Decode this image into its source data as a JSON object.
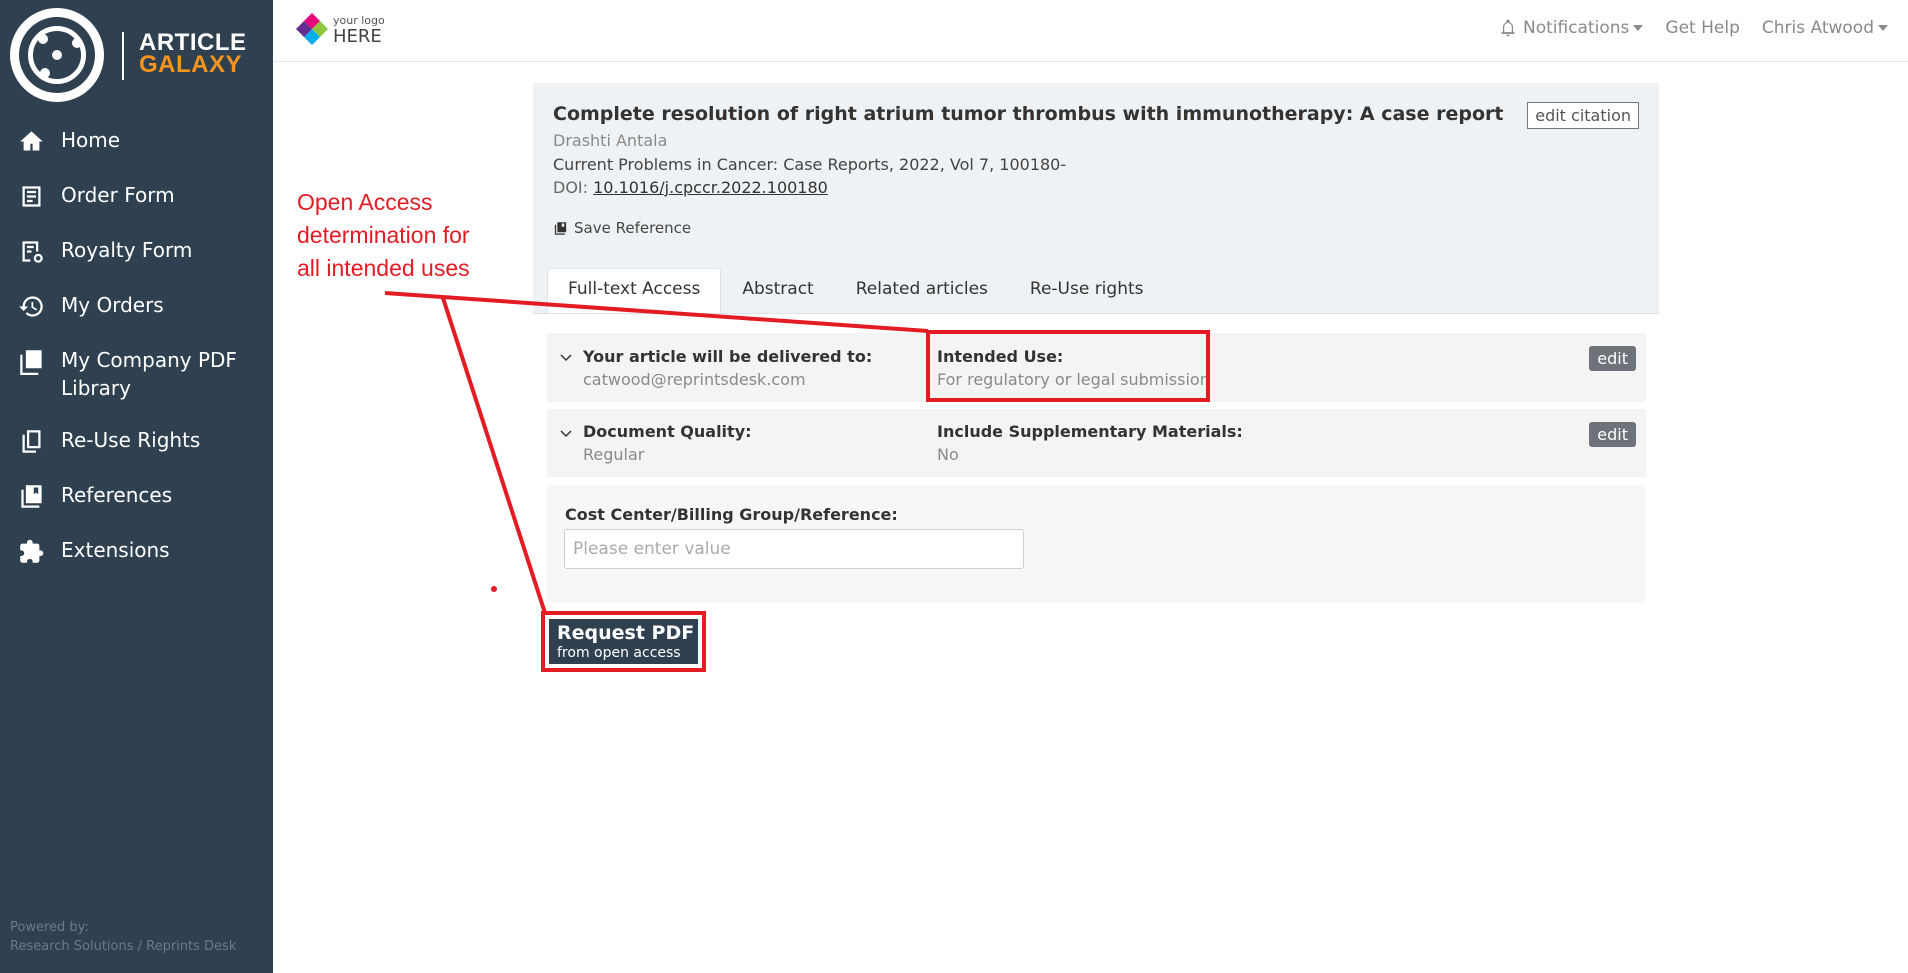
{
  "sidebar": {
    "brand": {
      "line1": "ARTICLE",
      "line2": "GALAXY"
    },
    "items": [
      {
        "label": "Home",
        "icon": "home-icon"
      },
      {
        "label": "Order Form",
        "icon": "form-icon"
      },
      {
        "label": "Royalty Form",
        "icon": "royalty-form-icon"
      },
      {
        "label": "My Orders",
        "icon": "history-icon"
      },
      {
        "label": "My Company PDF Library",
        "icon": "pdf-icon"
      },
      {
        "label": "Re-Use Rights",
        "icon": "copy-icon"
      },
      {
        "label": "References",
        "icon": "books-icon"
      },
      {
        "label": "Extensions",
        "icon": "puzzle-icon"
      }
    ],
    "footer": {
      "line1": "Powered by:",
      "line2": "Research Solutions / Reprints Desk"
    }
  },
  "topbar": {
    "logo_small": "your logo",
    "logo_big": "HERE",
    "notifications": "Notifications",
    "help": "Get Help",
    "user": "Chris Atwood"
  },
  "citation": {
    "title": "Complete resolution of right atrium tumor thrombus with immunotherapy: A case report",
    "author": "Drashti Antala",
    "journal": "Current Problems in Cancer: Case Reports, 2022, Vol 7, 100180-",
    "doi_label": "DOI:",
    "doi": "10.1016/j.cpccr.2022.100180",
    "save": "Save Reference",
    "edit": "edit citation"
  },
  "tabs": [
    "Full-text Access",
    "Abstract",
    "Related articles",
    "Re-Use rights"
  ],
  "delivery": {
    "label": "Your article will be delivered to:",
    "value": "catwood@reprintsdesk.com",
    "use_label": "Intended Use:",
    "use_value": "For regulatory or legal submission",
    "edit": "edit"
  },
  "quality": {
    "label": "Document Quality:",
    "value": "Regular",
    "supp_label": "Include Supplementary Materials:",
    "supp_value": "No",
    "edit": "edit"
  },
  "cost": {
    "label": "Cost Center/Billing Group/Reference:",
    "placeholder": "Please enter value"
  },
  "request": {
    "line1": "Request PDF",
    "line2": "from open access"
  },
  "annotation": {
    "lines": [
      "Open Access",
      "determination for",
      "all intended uses"
    ],
    "color": "#e31b23"
  }
}
